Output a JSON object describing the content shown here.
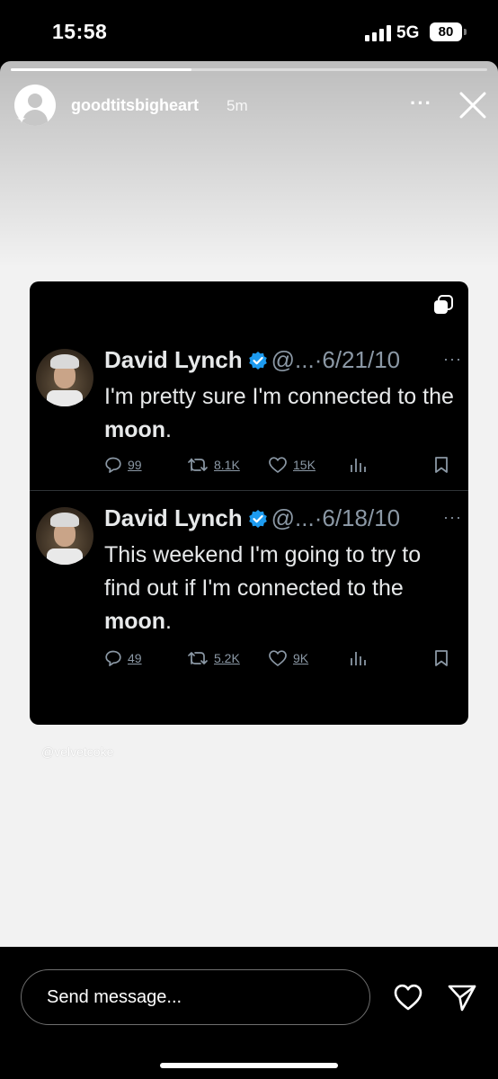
{
  "status_bar": {
    "time": "15:58",
    "network": "5G",
    "battery": "80"
  },
  "story": {
    "progress": 0.38,
    "username": "goodtitsbigheart",
    "time_ago": "5m",
    "more_icon": "more-horizontal-icon",
    "close_icon": "close-icon",
    "watermark": "@velvetcoke"
  },
  "tweets": [
    {
      "author": "David Lynch",
      "handle": "@...",
      "date": "·6/21/10",
      "text_before": "I'm pretty sure I'm connected to the ",
      "text_bold": "moon",
      "text_after": ".",
      "replies": "99",
      "retweets": "8.1K",
      "likes": "15K"
    },
    {
      "author": "David Lynch",
      "handle": "@...",
      "date": "·6/18/10",
      "text_before": "This weekend I'm going to try to find out if I'm connected to the ",
      "text_bold": "moon",
      "text_after": ".",
      "replies": "49",
      "retweets": "5.2K",
      "likes": "9K"
    }
  ],
  "bottom_bar": {
    "message_placeholder": "Send message..."
  },
  "colors": {
    "verified_blue": "#1d9bf0",
    "story_background": "#f2f2f2",
    "tweet_background": "#000000",
    "muted_text": "#8b98a5"
  }
}
